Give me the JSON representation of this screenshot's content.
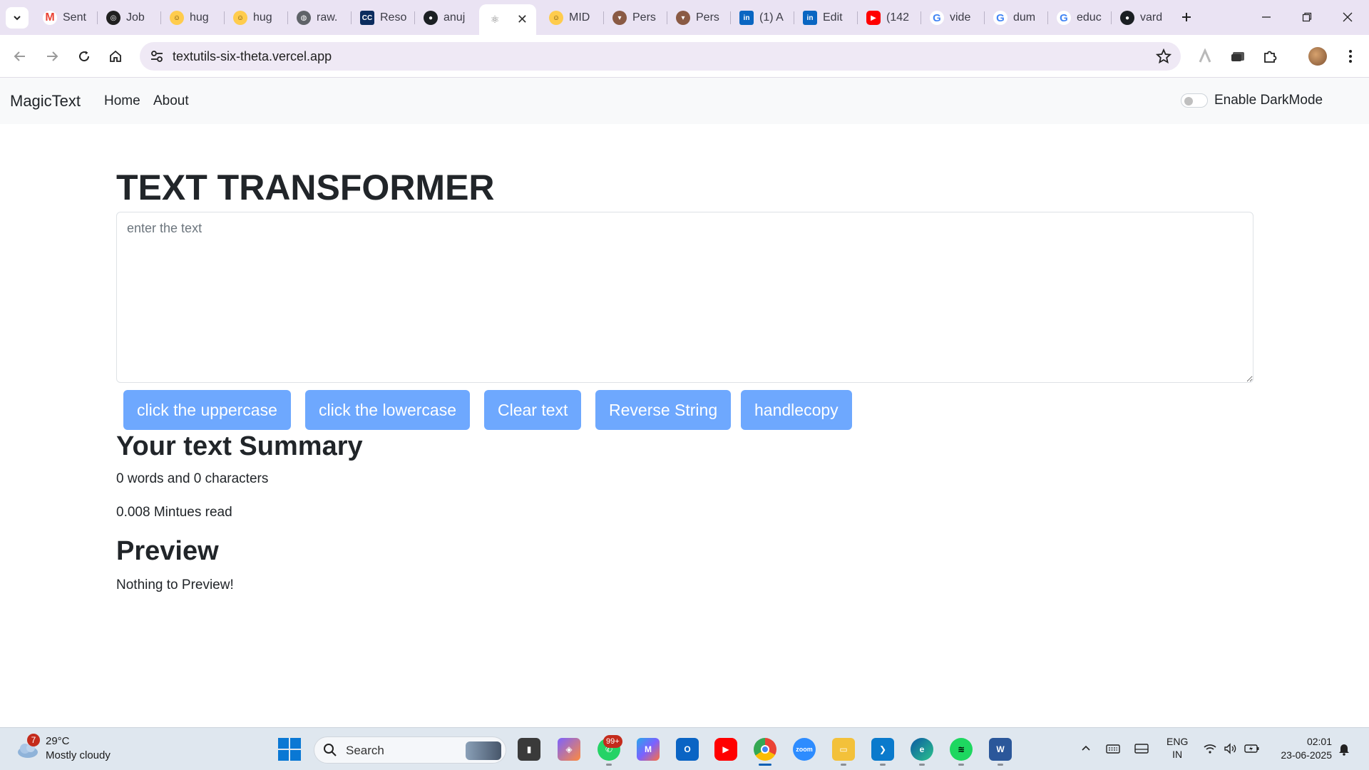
{
  "browser": {
    "tabs": [
      {
        "title": "Sent",
        "icon": "gmail-icon",
        "color": "#ea4335"
      },
      {
        "title": "Job",
        "icon": "openai-icon",
        "color": "#202020"
      },
      {
        "title": "hug",
        "icon": "huggingface-icon",
        "color": "#ffcc4d"
      },
      {
        "title": "hug",
        "icon": "huggingface-icon",
        "color": "#ffcc4d"
      },
      {
        "title": "raw.",
        "icon": "globe-icon",
        "color": "#5f6368"
      },
      {
        "title": "Reso",
        "icon": "cc-icon",
        "color": "#0b2c5e"
      },
      {
        "title": "anuj",
        "icon": "github-icon",
        "color": "#1b1f23"
      },
      {
        "title": "",
        "icon": "react-icon",
        "color": "#7a7a7a"
      },
      {
        "title": "MID",
        "icon": "huggingface-icon",
        "color": "#ffcc4d"
      },
      {
        "title": "Pers",
        "icon": "cup-icon",
        "color": "#8a5a44"
      },
      {
        "title": "Pers",
        "icon": "cup-icon",
        "color": "#8a5a44"
      },
      {
        "title": "(1) A",
        "icon": "linkedin-icon",
        "color": "#0a66c2"
      },
      {
        "title": "Edit",
        "icon": "linkedin-icon",
        "color": "#0a66c2"
      },
      {
        "title": "(142",
        "icon": "youtube-icon",
        "color": "#ff0000"
      },
      {
        "title": "vide",
        "icon": "google-icon",
        "color": "#4285f4"
      },
      {
        "title": "dum",
        "icon": "google-icon",
        "color": "#4285f4"
      },
      {
        "title": "educ",
        "icon": "google-icon",
        "color": "#4285f4"
      },
      {
        "title": "vard",
        "icon": "github-icon",
        "color": "#1b1f23"
      }
    ],
    "url": "textutils-six-theta.vercel.app"
  },
  "navbar": {
    "brand": "MagicText",
    "links": [
      "Home",
      "About"
    ],
    "darkmode_label": "Enable DarkMode"
  },
  "main": {
    "title": "TEXT TRANSFORMER",
    "textarea_placeholder": "enter the text",
    "buttons": [
      "click the uppercase",
      "click the lowercase",
      "Clear text",
      "Reverse String",
      "handlecopy"
    ],
    "summary_heading": "Your text Summary",
    "summary_counts": "0 words and 0 characters",
    "read_time": "0.008 Mintues read",
    "preview_heading": "Preview",
    "preview_text": "Nothing to Preview!"
  },
  "taskbar": {
    "weather_badge": "7",
    "weather_temp": "29°C",
    "weather_desc": "Mostly cloudy",
    "search_label": "Search",
    "whatsapp_badge": "99+",
    "language_line1": "ENG",
    "language_line2": "IN",
    "time": "02:01",
    "date": "23-06-2025"
  },
  "colors": {
    "accent_button": "#6ea8fe",
    "navbar_bg": "#f8f9fa",
    "tabbar_bg": "#eae3f3"
  }
}
